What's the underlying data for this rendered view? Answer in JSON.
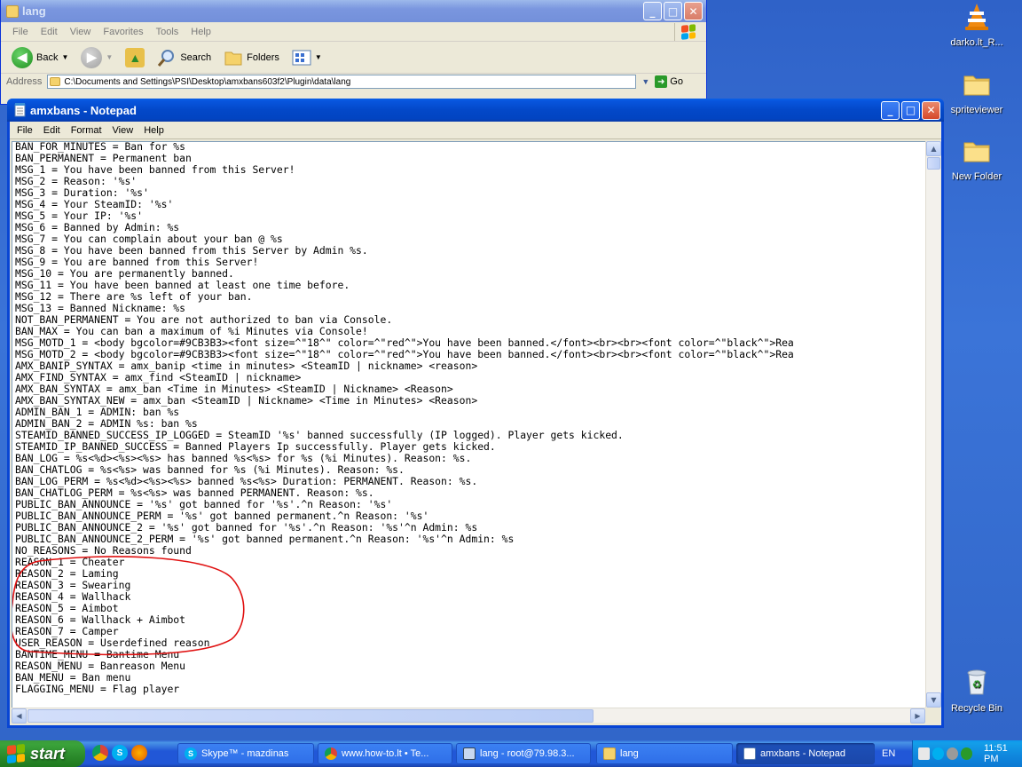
{
  "explorer": {
    "title": "lang",
    "menu": [
      "File",
      "Edit",
      "View",
      "Favorites",
      "Tools",
      "Help"
    ],
    "toolbar": {
      "back": "Back",
      "search": "Search",
      "folders": "Folders"
    },
    "address_label": "Address",
    "address_value": "C:\\Documents and Settings\\PSI\\Desktop\\amxbans603f2\\Plugin\\data\\lang",
    "go_label": "Go"
  },
  "notepad": {
    "title": "amxbans - Notepad",
    "menu": [
      "File",
      "Edit",
      "Format",
      "View",
      "Help"
    ],
    "lines": [
      "BAN_FOR_MINUTES = Ban for %s",
      "BAN_PERMANENT = Permanent ban",
      "MSG_1 = You have been banned from this Server!",
      "MSG_2 = Reason: '%s'",
      "MSG_3 = Duration: '%s'",
      "MSG_4 = Your SteamID: '%s'",
      "MSG_5 = Your IP: '%s'",
      "MSG_6 = Banned by Admin: %s",
      "MSG_7 = You can complain about your ban @ %s",
      "MSG_8 = You have been banned from this Server by Admin %s.",
      "MSG_9 = You are banned from this Server!",
      "MSG_10 = You are permanently banned.",
      "MSG_11 = You have been banned at least one time before.",
      "MSG_12 = There are %s left of your ban.",
      "MSG_13 = Banned Nickname: %s",
      "NOT_BAN_PERMANENT = You are not authorized to ban via Console.",
      "BAN_MAX = You can ban a maximum of %i Minutes via Console!",
      "MSG_MOTD_1 = <body bgcolor=#9CB3B3><font size=^\"18^\" color=^\"red^\">You have been banned.</font><br><br><font color=^\"black^\">Rea",
      "MSG_MOTD_2 = <body bgcolor=#9CB3B3><font size=^\"18^\" color=^\"red^\">You have been banned.</font><br><br><font color=^\"black^\">Rea",
      "AMX_BANIP_SYNTAX = amx_banip <time in minutes> <SteamID | nickname> <reason>",
      "AMX_FIND_SYNTAX = amx_find <SteamID | nickname>",
      "AMX_BAN_SYNTAX = amx_ban <Time in Minutes> <SteamID | Nickname> <Reason>",
      "AMX_BAN_SYNTAX_NEW = amx_ban <SteamID | Nickname> <Time in Minutes> <Reason>",
      "ADMIN_BAN_1 = ADMIN: ban %s",
      "ADMIN_BAN_2 = ADMIN %s: ban %s",
      "STEAMID_BANNED_SUCCESS_IP_LOGGED = SteamID '%s' banned successfully (IP logged). Player gets kicked.",
      "STEAMID_IP_BANNED_SUCCESS = Banned Players Ip successfully. Player gets kicked.",
      "BAN_LOG = %s<%d><%s><%s> has banned %s<%s> for %s (%i Minutes). Reason: %s.",
      "BAN_CHATLOG = %s<%s> was banned for %s (%i Minutes). Reason: %s.",
      "BAN_LOG_PERM = %s<%d><%s><%s> banned %s<%s> Duration: PERMANENT. Reason: %s.",
      "BAN_CHATLOG_PERM = %s<%s> was banned PERMANENT. Reason: %s.",
      "PUBLIC_BAN_ANNOUNCE = '%s' got banned for '%s'.^n Reason: '%s'",
      "PUBLIC_BAN_ANNOUNCE_PERM = '%s' got banned permanent.^n Reason: '%s'",
      "PUBLIC_BAN_ANNOUNCE_2 = '%s' got banned for '%s'.^n Reason: '%s'^n Admin: %s",
      "PUBLIC_BAN_ANNOUNCE_2_PERM = '%s' got banned permanent.^n Reason: '%s'^n Admin: %s",
      "NO_REASONS = No Reasons found",
      "REASON_1 = Cheater",
      "REASON_2 = Laming",
      "REASON_3 = Swearing",
      "REASON_4 = Wallhack",
      "REASON_5 = Aimbot",
      "REASON_6 = Wallhack + Aimbot",
      "REASON_7 = Camper",
      "USER_REASON = Userdefined reason",
      "BANTIME_MENU = Bantime Menu",
      "REASON_MENU = Banreason Menu",
      "BAN_MENU = Ban menu",
      "FLAGGING_MENU = Flag player"
    ],
    "annotation_color": "#e01010"
  },
  "desktop_icons": [
    {
      "label": "darko.lt_R...",
      "icon": "vlc-cone-icon"
    },
    {
      "label": "spriteviewer",
      "icon": "folder-icon"
    },
    {
      "label": "New Folder",
      "icon": "folder-icon"
    },
    {
      "label": "Recycle Bin",
      "icon": "recycle-bin-icon"
    }
  ],
  "taskbar": {
    "start_label": "start",
    "tasks": [
      {
        "label": "Skype™ - mazdinas",
        "icon": "skype-icon"
      },
      {
        "label": "www.how-to.lt • Te...",
        "icon": "chrome-icon"
      },
      {
        "label": "lang - root@79.98.3...",
        "icon": "putty-icon"
      },
      {
        "label": "lang",
        "icon": "folder-icon"
      },
      {
        "label": "amxbans - Notepad",
        "icon": "notepad-icon"
      }
    ],
    "language": "EN",
    "clock": "11:51 PM"
  },
  "colors": {
    "xp_blue": "#0348c8",
    "start_green": "#2b8a2b",
    "desktop": "#3b74d8"
  }
}
